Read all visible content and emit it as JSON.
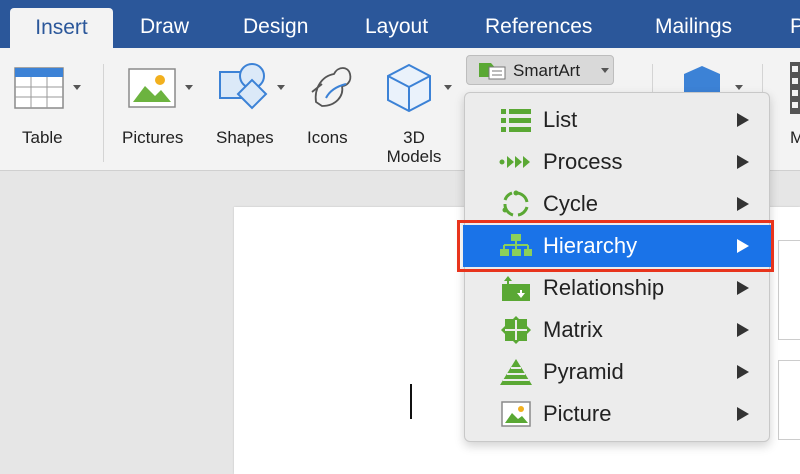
{
  "tabs": [
    {
      "label": "Insert",
      "active": true
    },
    {
      "label": "Draw"
    },
    {
      "label": "Design"
    },
    {
      "label": "Layout"
    },
    {
      "label": "References"
    },
    {
      "label": "Mailings"
    },
    {
      "label": "P"
    }
  ],
  "ribbon": {
    "table_label": "Table",
    "pictures_label": "Pictures",
    "shapes_label": "Shapes",
    "icons_label": "Icons",
    "models_label_1": "3D",
    "models_label_2": "Models",
    "smartart_label": "SmartArt",
    "cut_label": "M"
  },
  "menu": {
    "items": [
      {
        "label": "List",
        "icon": "list-icon"
      },
      {
        "label": "Process",
        "icon": "process-icon"
      },
      {
        "label": "Cycle",
        "icon": "cycle-icon"
      },
      {
        "label": "Hierarchy",
        "icon": "hierarchy-icon",
        "selected": true
      },
      {
        "label": "Relationship",
        "icon": "relationship-icon"
      },
      {
        "label": "Matrix",
        "icon": "matrix-icon"
      },
      {
        "label": "Pyramid",
        "icon": "pyramid-icon"
      },
      {
        "label": "Picture",
        "icon": "picture-icon"
      }
    ]
  },
  "colors": {
    "tab_bar": "#2b579a",
    "selection": "#1a73e8",
    "highlight": "#e8341c",
    "smartart_green": "#5aa834"
  }
}
